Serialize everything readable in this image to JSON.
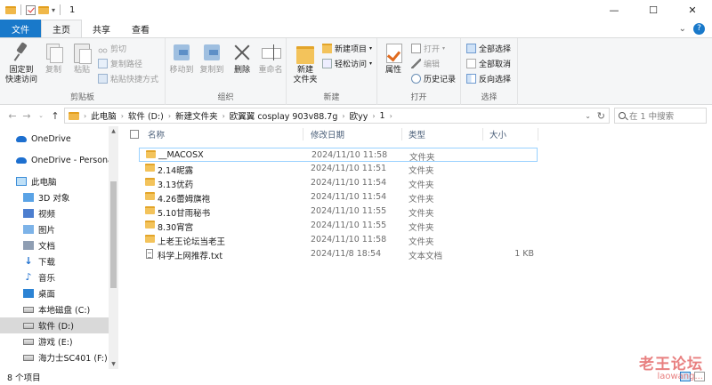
{
  "titlebar": {
    "title": "1",
    "qa_dropdown": "▾",
    "minimize": "—",
    "maximize": "☐",
    "close": "✕"
  },
  "tabs": [
    {
      "label": "文件"
    },
    {
      "label": "主页"
    },
    {
      "label": "共享"
    },
    {
      "label": "查看"
    }
  ],
  "ribbon": {
    "pin_quick_access": "固定到\n快速访问",
    "copy": "复制",
    "paste": "粘贴",
    "cut": "剪切",
    "copy_path": "复制路径",
    "paste_shortcut": "粘贴快捷方式",
    "clipboard_label": "剪贴板",
    "move_to": "移动到",
    "copy_to": "复制到",
    "delete": "删除",
    "rename": "重命名",
    "organize_label": "组织",
    "new_folder": "新建\n文件夹",
    "new_item": "新建项目",
    "easy_access": "轻松访问",
    "new_label": "新建",
    "properties": "属性",
    "open": "打开",
    "edit": "编辑",
    "history": "历史记录",
    "open_label": "打开",
    "select_all": "全部选择",
    "select_none": "全部取消",
    "invert_selection": "反向选择",
    "select_label": "选择"
  },
  "address": {
    "segments": [
      "此电脑",
      "软件 (D:)",
      "新建文件夹",
      "欧翼翼 cosplay 903v88.7g",
      "欧yy",
      "1"
    ]
  },
  "search": {
    "placeholder": "在 1 中搜索"
  },
  "nav": [
    {
      "label": "OneDrive",
      "icon": "onedrive-cloud-icon"
    },
    {
      "label": "OneDrive - Personal",
      "icon": "onedrive-cloud-icon"
    },
    {
      "label": "此电脑",
      "icon": "this-pc-icon"
    },
    {
      "label": "3D 对象",
      "icon": "3d-objects-icon"
    },
    {
      "label": "视频",
      "icon": "videos-icon"
    },
    {
      "label": "图片",
      "icon": "pictures-icon"
    },
    {
      "label": "文档",
      "icon": "documents-icon"
    },
    {
      "label": "下载",
      "icon": "downloads-icon"
    },
    {
      "label": "音乐",
      "icon": "music-icon"
    },
    {
      "label": "桌面",
      "icon": "desktop-icon"
    },
    {
      "label": "本地磁盘 (C:)",
      "icon": "drive-icon"
    },
    {
      "label": "软件 (D:)",
      "icon": "drive-icon",
      "selected": true
    },
    {
      "label": "游戏 (E:)",
      "icon": "drive-icon"
    },
    {
      "label": "海力士SC401 (F:)",
      "icon": "drive-icon"
    }
  ],
  "columns": {
    "name": "名称",
    "date": "修改日期",
    "type": "类型",
    "size": "大小"
  },
  "files": [
    {
      "name": "__MACOSX",
      "date": "2024/11/10 11:58",
      "type": "文件夹",
      "size": "",
      "icon": "folder-icon"
    },
    {
      "name": "2.14昵露",
      "date": "2024/11/10 11:51",
      "type": "文件夹",
      "size": "",
      "icon": "folder-icon"
    },
    {
      "name": "3.13优药",
      "date": "2024/11/10 11:54",
      "type": "文件夹",
      "size": "",
      "icon": "folder-icon"
    },
    {
      "name": "4.26蕾姆旗袍",
      "date": "2024/11/10 11:54",
      "type": "文件夹",
      "size": "",
      "icon": "folder-icon"
    },
    {
      "name": "5.10甘雨秘书",
      "date": "2024/11/10 11:55",
      "type": "文件夹",
      "size": "",
      "icon": "folder-icon"
    },
    {
      "name": "8.30宵宫",
      "date": "2024/11/10 11:55",
      "type": "文件夹",
      "size": "",
      "icon": "folder-icon"
    },
    {
      "name": "上老王论坛当老王",
      "date": "2024/11/10 11:58",
      "type": "文件夹",
      "size": "",
      "icon": "folder-icon"
    },
    {
      "name": "科学上网推荐.txt",
      "date": "2024/11/8 18:54",
      "type": "文本文档",
      "size": "1 KB",
      "icon": "text-file-icon"
    }
  ],
  "status": {
    "count": "8 个项目"
  },
  "watermark": {
    "line1": "老王论坛",
    "line2": "laowang..."
  }
}
